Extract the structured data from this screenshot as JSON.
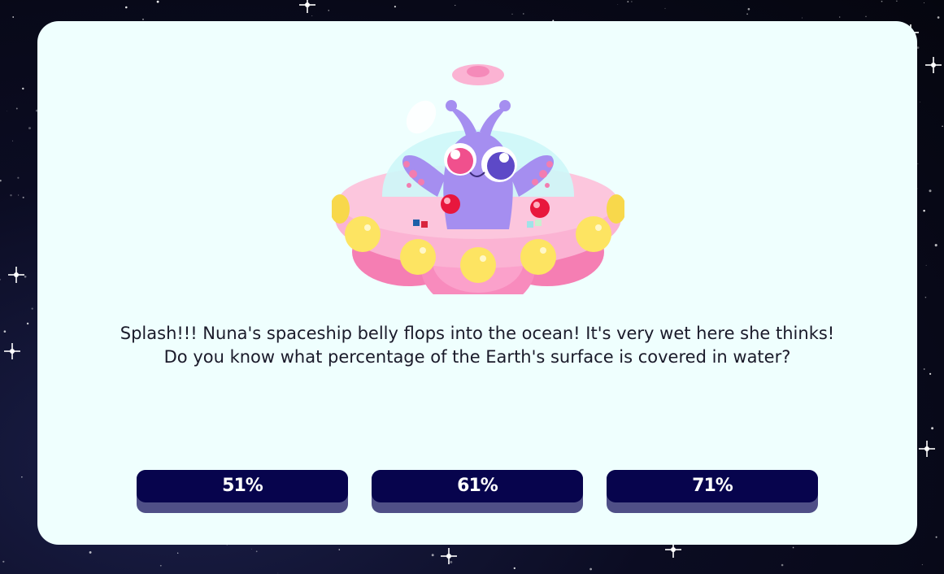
{
  "quiz": {
    "question": "Splash!!! Nuna's spaceship belly flops into the ocean! It's very wet here she thinks! Do you know what percentage of the Earth's surface is covered in water?",
    "answers": [
      "51%",
      "61%",
      "71%"
    ]
  },
  "illustration": {
    "subject": "alien-in-spaceship",
    "colors": {
      "saucer": "#f9a6c9",
      "dome": "#cdf7f8",
      "alien": "#a58ef0",
      "lights": "#fde462"
    }
  },
  "colors": {
    "card_background": "#effffe",
    "button_face": "#07044d",
    "button_shadow": "#4f4f87",
    "space_background": "#0b0c22"
  }
}
